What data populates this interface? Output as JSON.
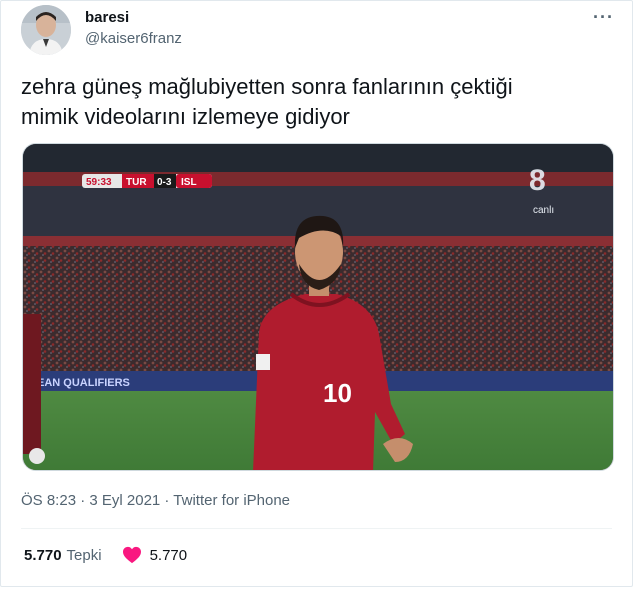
{
  "user": {
    "display_name": "baresi",
    "handle": "@kaiser6franz"
  },
  "tweet": {
    "text": "zehra güneş mağlubiyetten sonra fanlarının çektiği\nmimik videolarını izlemeye gidiyor",
    "timestamp": "ÖS 8:23 · 3 Eyl 2021 · Twitter for iPhone"
  },
  "stats": {
    "reactions_count": "5.770",
    "reactions_label": "Tepki",
    "likes_count": "5.770"
  },
  "media": {
    "scoreboard": {
      "time": "59:33",
      "home": "TUR",
      "score": "0-3",
      "away": "ISL"
    },
    "channel": "canlı",
    "player_number": "10",
    "board_text": "EAN QUALIFIERS"
  },
  "colors": {
    "heart": "#f91880",
    "text_secondary": "#536471",
    "text_primary": "#0f1419"
  }
}
